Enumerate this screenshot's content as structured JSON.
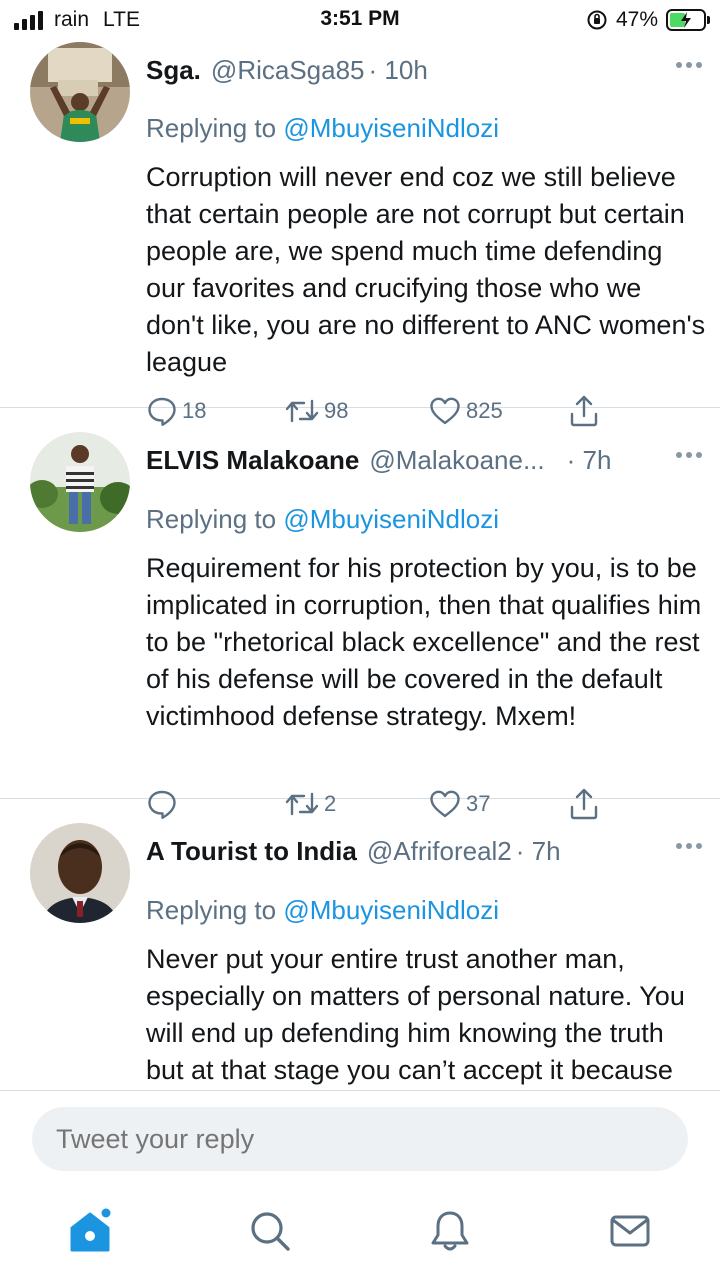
{
  "status_bar": {
    "carrier": "rain",
    "network": "LTE",
    "time": "3:51 PM",
    "battery": "47%",
    "battery_level": 0.47
  },
  "tweets": [
    {
      "name": "Sga.",
      "handle": "@RicaSga85",
      "time": "· 10h",
      "replying_label": "Replying to",
      "replying_to": "@MbuyiseniNdlozi",
      "text": "Corruption will never end coz we still believe that certain people are not corrupt but certain people are, we spend much time defending our favorites and crucifying those who we don't like, you are no different to ANC women's league",
      "replies": "18",
      "retweets": "98",
      "likes": "825"
    },
    {
      "name": "ELVIS Malakoane",
      "handle": "@Malakoane...",
      "time": "· 7h",
      "replying_label": "Replying to",
      "replying_to": "@MbuyiseniNdlozi",
      "text": "Requirement for his protection by you, is to be  implicated in corruption, then that qualifies him to be \"rhetorical black excellence\" and the rest of his defense will be covered in the default victimhood defense strategy. Mxem!",
      "replies": "",
      "retweets": "2",
      "likes": "37"
    },
    {
      "name": "A Tourist to India",
      "handle": "@Afriforeal2",
      "time": "· 7h",
      "replying_label": "Replying to",
      "replying_to": "@MbuyiseniNdlozi",
      "text": "Never put your entire trust another man, especially on matters of personal nature. You will end up defending him knowing the truth but at that stage you can’t accept it because you were clouded by",
      "replies": "",
      "retweets": "",
      "likes": ""
    }
  ],
  "reply_box": {
    "placeholder": "Tweet your reply"
  },
  "tabs": [
    "home-icon",
    "search-icon",
    "notifications-icon",
    "messages-icon"
  ],
  "colors": {
    "accent": "#1b95e0",
    "secondary_text": "#5b7083",
    "divider": "#d8dde1"
  }
}
